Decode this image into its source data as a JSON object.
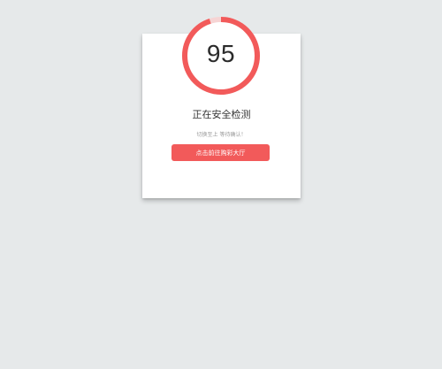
{
  "progress": {
    "value_text": "95",
    "fraction": 0.95,
    "ring_color": "#f25a5a",
    "track_color": "#f6d4d4"
  },
  "status": {
    "title": "正在安全检测",
    "subtitle": "切换至上 等待确认！"
  },
  "action": {
    "button_label": "点击前往购彩大厅",
    "button_color": "#f25a5a"
  },
  "colors": {
    "background": "#e6e9ea",
    "card": "#ffffff"
  }
}
